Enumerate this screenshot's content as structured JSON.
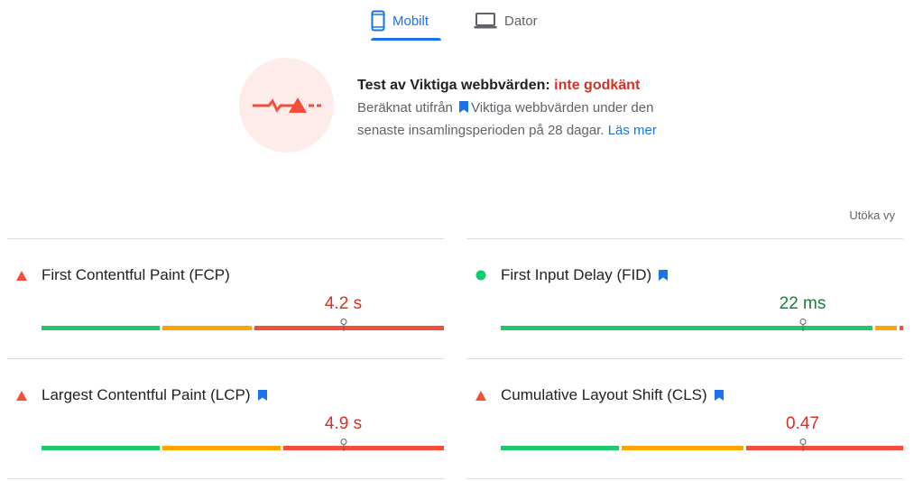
{
  "tabs": [
    {
      "label": "Mobilt",
      "active": true,
      "icon": "smartphone-icon"
    },
    {
      "label": "Dator",
      "active": false,
      "icon": "laptop-icon"
    }
  ],
  "assessment": {
    "title_prefix": "Test av Viktiga webbvärden: ",
    "status": "inte godkänt",
    "desc_part1": "Beräknat utifrån",
    "desc_part2": "Viktiga webbvärden under den senaste insamlingsperioden på 28 dagar.",
    "link": "Läs mer",
    "icon": "failed-assessment-icon"
  },
  "expand_label": "Utöka vy",
  "colors": {
    "accent": "#1a73e8",
    "fail": "#d93025",
    "pass": "#188038",
    "good": "#1fc86a",
    "average": "#ffa400",
    "poor": "#f44e3b",
    "bookmark": "#1a73e8"
  },
  "metrics": [
    {
      "name": "First Contentful Paint (FCP)",
      "value": "4.2 s",
      "status": "poor",
      "core": false,
      "distribution": [
        0.3,
        0.23,
        0.47
      ],
      "marker": 0.75
    },
    {
      "name": "First Input Delay (FID)",
      "value": "22 ms",
      "status": "good",
      "core": true,
      "distribution": [
        0.93,
        0.06,
        0.01
      ],
      "marker": 0.75
    },
    {
      "name": "Largest Contentful Paint (LCP)",
      "value": "4.9 s",
      "status": "poor",
      "core": true,
      "distribution": [
        0.3,
        0.3,
        0.4
      ],
      "marker": 0.75
    },
    {
      "name": "Cumulative Layout Shift (CLS)",
      "value": "0.47",
      "status": "poor",
      "core": true,
      "distribution": [
        0.3,
        0.31,
        0.39
      ],
      "marker": 0.75
    }
  ]
}
